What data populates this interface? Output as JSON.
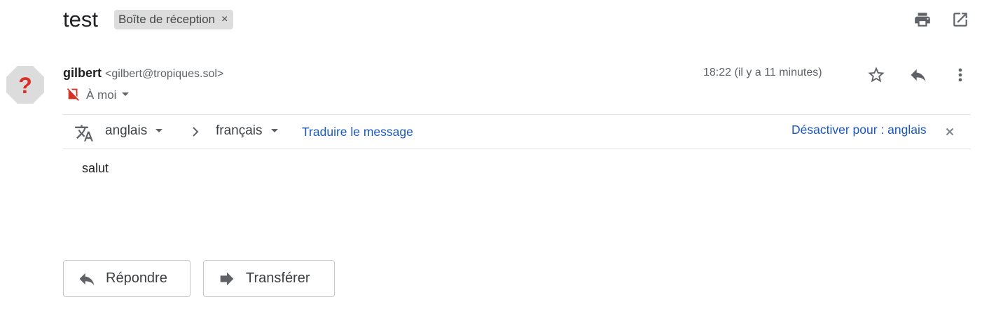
{
  "header": {
    "subject": "test",
    "label_chip": "Boîte de réception",
    "label_remove": "×"
  },
  "message": {
    "sender_name": "gilbert",
    "sender_email": "<gilbert@tropiques.sol>",
    "timestamp": "18:22 (il y a 11 minutes)",
    "recipient": "À moi",
    "body": "salut"
  },
  "translation": {
    "source_language": "anglais",
    "target_language": "français",
    "translate_link": "Traduire le message",
    "disable_link": "Désactiver pour : anglais"
  },
  "actions": {
    "reply_label": "Répondre",
    "forward_label": "Transférer"
  },
  "icons": {
    "print": "print-icon",
    "open_new_window": "open-new-window-icon",
    "avatar": "unknown-sender-avatar",
    "star": "star-icon",
    "reply": "reply-icon",
    "more": "more-vert-icon",
    "important_marker": "label-off-icon",
    "translate": "translate-icon",
    "dismiss": "close-icon"
  },
  "colors": {
    "link_blue": "#1a56c4",
    "avatar_red": "#d93025",
    "avatar_bg": "#dcdcdc",
    "chip_bg": "#dddddd"
  }
}
